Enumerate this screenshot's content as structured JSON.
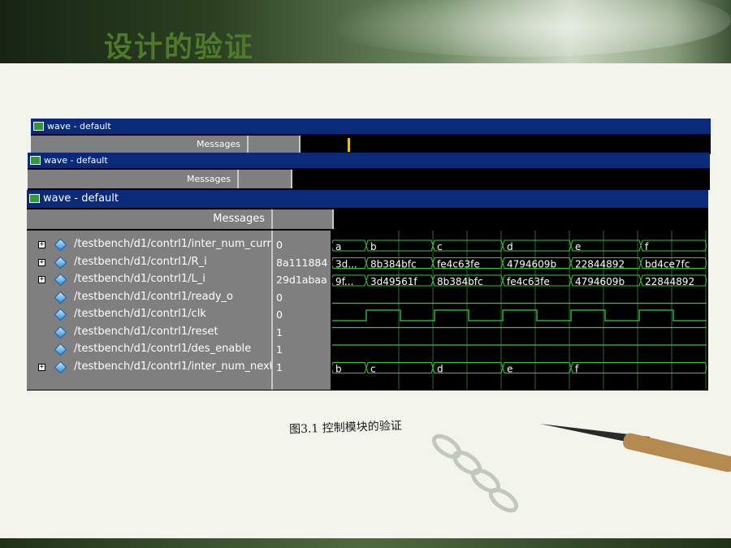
{
  "slide": {
    "title": "设计的验证",
    "caption": "图3.1  控制模块的验证"
  },
  "windows": [
    {
      "title": "wave - default",
      "header": "Messages"
    },
    {
      "title": "wave - default",
      "header": "Messages"
    },
    {
      "title": "wave - default",
      "header": "Messages"
    }
  ],
  "signals": [
    {
      "name": "/testbench/d1/contrl1/inter_num_curr",
      "value": "0",
      "expandable": true,
      "type": "bus",
      "segments": [
        "a",
        "b",
        "c",
        "d",
        "e",
        "f"
      ]
    },
    {
      "name": "/testbench/d1/contrl1/R_i",
      "value": "8a111884",
      "expandable": true,
      "type": "bus",
      "segments": [
        "3d...",
        "8b384bfc",
        "fe4c63fe",
        "4794609b",
        "22844892",
        "bd4ce7fc"
      ]
    },
    {
      "name": "/testbench/d1/contrl1/L_i",
      "value": "29d1abaa",
      "expandable": true,
      "type": "bus",
      "segments": [
        "9f...",
        "3d49561f",
        "8b384bfc",
        "fe4c63fe",
        "4794609b",
        "22844892"
      ]
    },
    {
      "name": "/testbench/d1/contrl1/ready_o",
      "value": "0",
      "expandable": false,
      "type": "low"
    },
    {
      "name": "/testbench/d1/contrl1/clk",
      "value": "0",
      "expandable": false,
      "type": "clock"
    },
    {
      "name": "/testbench/d1/contrl1/reset",
      "value": "1",
      "expandable": false,
      "type": "high"
    },
    {
      "name": "/testbench/d1/contrl1/des_enable",
      "value": "1",
      "expandable": false,
      "type": "high"
    },
    {
      "name": "/testbench/d1/contrl1/inter_num_next",
      "value": "1",
      "expandable": true,
      "type": "bus",
      "segments": [
        "b",
        "c",
        "d",
        "e",
        "f"
      ]
    }
  ],
  "colors": {
    "wave": "#33cc33",
    "grid": "#2e6b2e",
    "titlebar": "#0b2a7a",
    "panel": "#7f7f7f",
    "cursor": "#e8c21c",
    "title_text": "#4f7a2c"
  }
}
